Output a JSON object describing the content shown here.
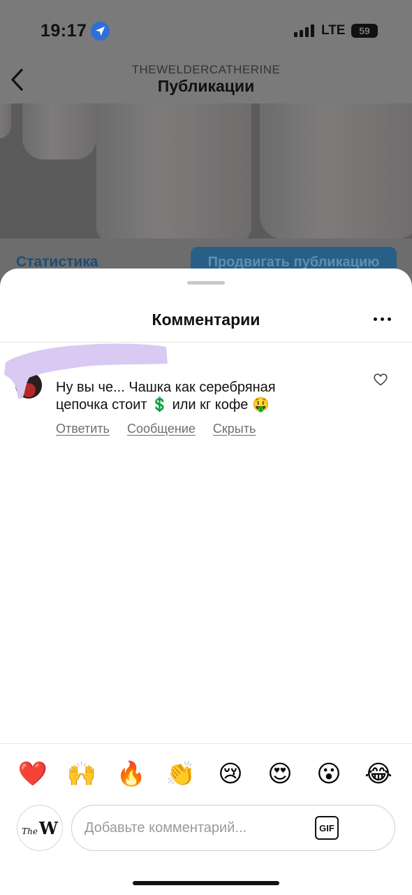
{
  "status_bar": {
    "time": "19:17",
    "carrier": "LTE",
    "battery": "59"
  },
  "header": {
    "username": "THEWELDERCATHERINE",
    "title": "Публикации"
  },
  "post_actions": {
    "stats_label": "Статистика",
    "promote_label": "Продвигать публикацию"
  },
  "sheet": {
    "title": "Комментарии"
  },
  "comment": {
    "text": "Ну вы че... Чашка как серебряная цепочка стоит 💲 или кг кофе 🤑",
    "actions": {
      "reply": "Ответить",
      "message": "Сообщение",
      "hide": "Скрыть"
    }
  },
  "quick_reactions": [
    "❤️",
    "🙌",
    "🔥",
    "👏",
    "😢",
    "😍",
    "😮",
    "😂"
  ],
  "composer": {
    "avatar_logo_small": "The",
    "avatar_logo_big": "W",
    "placeholder": "Добавьте комментарий...",
    "gif_label": "GIF"
  },
  "colors": {
    "link": "#1d4d77",
    "promote_bg": "#295f86",
    "redaction": "#d9c9f3",
    "location_icon": "#2f6fd9"
  }
}
